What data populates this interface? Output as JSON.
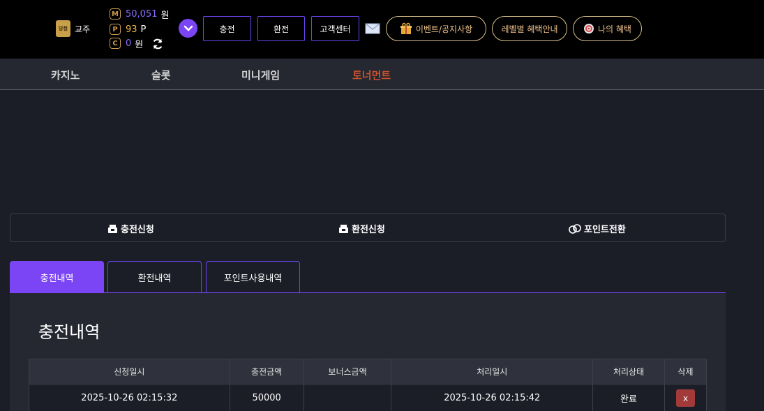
{
  "header": {
    "badge_text": "당첨",
    "username": "교주",
    "balances": [
      {
        "icon_letter": "M",
        "value": "50,051",
        "unit": "원"
      },
      {
        "icon_letter": "P",
        "value": "93",
        "unit": "P"
      },
      {
        "icon_letter": "C",
        "value": "0",
        "unit": "원"
      }
    ],
    "buttons": {
      "charge": "충전",
      "exchange": "환전",
      "support": "고객센터"
    },
    "pills": {
      "events": "이벤트/공지사항",
      "levels": "레벨별 혜택안내",
      "benefits": "나의 혜택"
    },
    "icons": [
      "badge-icon",
      "refresh-icon",
      "chevron-down-icon",
      "mail-icon",
      "gift-icon",
      "target-icon"
    ],
    "accent_color": "#7b45f5"
  },
  "nav": {
    "items": [
      {
        "label": "카지노"
      },
      {
        "label": "슬롯"
      },
      {
        "label": "미니게임"
      },
      {
        "label": "토너먼트",
        "active": true
      }
    ],
    "active_color": "#c7502e"
  },
  "actions": [
    {
      "label": "충전신청",
      "icon": "cash-register-icon"
    },
    {
      "label": "환전신청",
      "icon": "cash-register-icon"
    },
    {
      "label": "포인트전환",
      "icon": "coins-icon"
    }
  ],
  "tabs": [
    {
      "label": "충전내역",
      "active": true
    },
    {
      "label": "환전내역"
    },
    {
      "label": "포인트사용내역"
    }
  ],
  "panel": {
    "title": "충전내역",
    "columns": [
      "신청일시",
      "충전금액",
      "보너스금액",
      "처리일시",
      "처리상태",
      "삭제"
    ],
    "rows": [
      {
        "requested": "2025-10-26 02:15:32",
        "amount": "50000",
        "bonus": "",
        "processed": "2025-10-26 02:15:42",
        "status": "완료",
        "delete": "x"
      }
    ]
  }
}
